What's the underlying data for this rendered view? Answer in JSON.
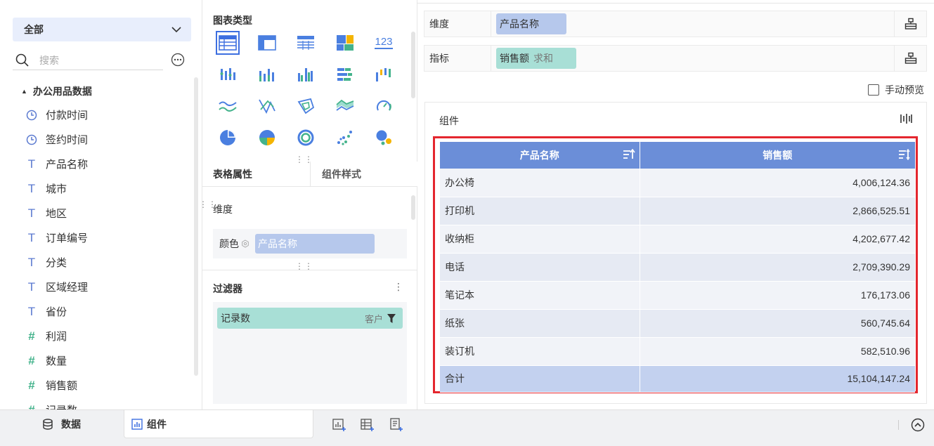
{
  "left": {
    "scope_label": "全部",
    "search_placeholder": "搜索",
    "dataset_name": "办公用品数据",
    "fields": [
      {
        "label": "付款时间",
        "type": "date"
      },
      {
        "label": "签约时间",
        "type": "date"
      },
      {
        "label": "产品名称",
        "type": "text"
      },
      {
        "label": "城市",
        "type": "text"
      },
      {
        "label": "地区",
        "type": "text"
      },
      {
        "label": "订单编号",
        "type": "text"
      },
      {
        "label": "分类",
        "type": "text"
      },
      {
        "label": "区域经理",
        "type": "text"
      },
      {
        "label": "省份",
        "type": "text"
      },
      {
        "label": "利润",
        "type": "number"
      },
      {
        "label": "数量",
        "type": "number"
      },
      {
        "label": "销售额",
        "type": "number"
      },
      {
        "label": "记录数",
        "type": "number"
      }
    ]
  },
  "middle": {
    "chart_types_title": "图表类型",
    "chart_type_icons": [
      "table-icon",
      "crosstab-icon",
      "detail-table-icon",
      "treemap-icon",
      "kpi-number-icon",
      "dot-column-icon",
      "stacked-column-icon",
      "grouped-column-icon",
      "bar-icon",
      "waterfall-icon",
      "line-icon",
      "radar-icon",
      "polygon-icon",
      "area-icon",
      "gauge-icon",
      "pie-icon",
      "multi-pie-icon",
      "ring-icon",
      "scatter-icon",
      "bubble-icon"
    ],
    "kpi_label": "123",
    "tab_table_props": "表格属性",
    "tab_component_style": "组件样式",
    "dimension_label": "维度",
    "color_label": "颜色",
    "color_field": "产品名称",
    "filter_title": "过滤器",
    "filter_field": "记录数",
    "filter_scope": "客户"
  },
  "right": {
    "dimension_label": "维度",
    "dimension_field": "产品名称",
    "metric_label": "指标",
    "metric_field": "销售额",
    "metric_agg": "求和",
    "manual_preview_label": "手动预览",
    "component_title": "组件",
    "table": {
      "headers": [
        "产品名称",
        "销售额"
      ],
      "rows": [
        [
          "办公椅",
          "4,006,124.36"
        ],
        [
          "打印机",
          "2,866,525.51"
        ],
        [
          "收纳柜",
          "4,202,677.42"
        ],
        [
          "电话",
          "2,709,390.29"
        ],
        [
          "笔记本",
          "176,173.06"
        ],
        [
          "纸张",
          "560,745.64"
        ],
        [
          "装订机",
          "582,510.96"
        ]
      ],
      "total_label": "合计",
      "total_value": "15,104,147.24"
    }
  },
  "bottom": {
    "data_tab": "数据",
    "component_tab": "组件"
  },
  "colors": {
    "accent": "#3d6fe0",
    "header_blue": "#6b8ed8",
    "dimension_pill": "#b6c8ec",
    "metric_pill": "#a8dfd6",
    "highlight_frame": "#e4262e"
  }
}
